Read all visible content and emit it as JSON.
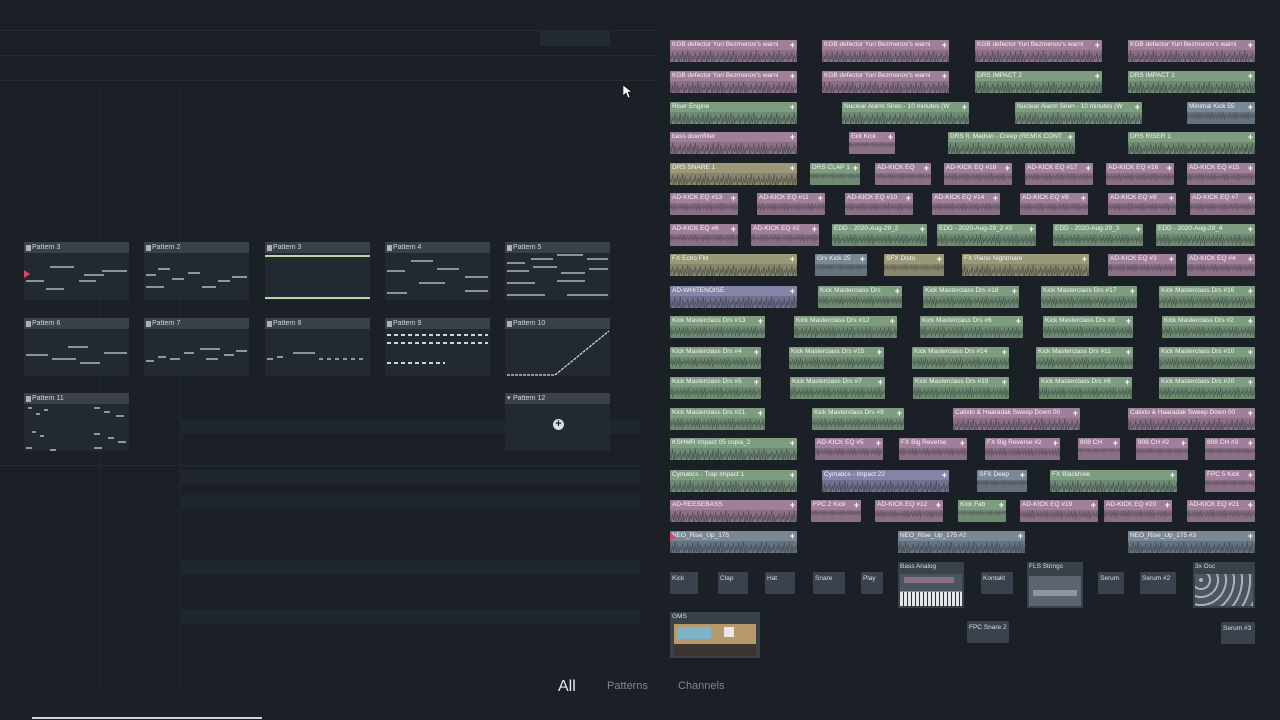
{
  "tabs": [
    {
      "label": "All",
      "active": true
    },
    {
      "label": "Patterns",
      "active": false
    },
    {
      "label": "Channels",
      "active": false
    }
  ],
  "patterns": [
    {
      "label": "Pattern 3"
    },
    {
      "label": "Pattern 2"
    },
    {
      "label": "Pattern 3"
    },
    {
      "label": "Pattern 4"
    },
    {
      "label": "Pattern 5"
    },
    {
      "label": "Pattern 6"
    },
    {
      "label": "Pattern 7"
    },
    {
      "label": "Pattern 8"
    },
    {
      "label": "Pattern 9"
    },
    {
      "label": "Pattern 10"
    },
    {
      "label": "Pattern 11"
    },
    {
      "label": "Pattern 12"
    }
  ],
  "clips": [
    {
      "label": "KGB defector Yuri Bezmenov's warni"
    },
    {
      "label": "KGB defector Yuri Bezmenov's warni"
    },
    {
      "label": "KGB defector Yuri Bezmenov's warni"
    },
    {
      "label": "KGB defector Yuri Bezmenov's warni"
    },
    {
      "label": "KGB defector Yuri Bezmenov's warni"
    },
    {
      "label": "KGB defector Yuri Bezmenov's warni"
    },
    {
      "label": "DRS IMPACT 2"
    },
    {
      "label": "DRS IMPACT 1"
    },
    {
      "label": "Riser Engine"
    },
    {
      "label": "Nuclear Alarm Siren - 10 minutes (W"
    },
    {
      "label": "Nuclear Alarm Siren - 10 minutes (W"
    },
    {
      "label": "Minimal Kick 55"
    },
    {
      "label": "bass downfilter"
    },
    {
      "label": "Ekit Kick"
    },
    {
      "label": "DRS ft. Madsin - Creep (REMIX CONT"
    },
    {
      "label": "DRS RISER 1"
    },
    {
      "label": "DRS SNARE 1"
    },
    {
      "label": "DRS CLAP 1"
    },
    {
      "label": "AD-KICK EQ"
    },
    {
      "label": "AD-KICK EQ #18"
    },
    {
      "label": "AD-KICK EQ #17"
    },
    {
      "label": "AD-KICK EQ #16"
    },
    {
      "label": "AD-KICK EQ #15"
    },
    {
      "label": "AD-KICK EQ #13"
    },
    {
      "label": "AD-KICK EQ #11"
    },
    {
      "label": "AD-KICK EQ #10"
    },
    {
      "label": "AD-KICK EQ #14"
    },
    {
      "label": "AD-KICK EQ #9"
    },
    {
      "label": "AD-KICK EQ #8"
    },
    {
      "label": "AD-KICK EQ #7"
    },
    {
      "label": "AD-KICK EQ #6"
    },
    {
      "label": "AD-KICK EQ #2"
    },
    {
      "label": "EDD - 2020-Aug-29_2"
    },
    {
      "label": "EDD - 2020-Aug-29_2 #2"
    },
    {
      "label": "EDD - 2020-Aug-29_3"
    },
    {
      "label": "EDD - 2020-Aug-29_4"
    },
    {
      "label": "FX Echo FM"
    },
    {
      "label": "Grv Kick 25"
    },
    {
      "label": "SFX Disto"
    },
    {
      "label": "FX Piano Nightmare"
    },
    {
      "label": "AD-KICK EQ #3"
    },
    {
      "label": "AD-KICK EQ #4"
    },
    {
      "label": "AD-WHITENOISE"
    },
    {
      "label": "Kick Masterclass Drs"
    },
    {
      "label": "Kick Masterclass Drs #18"
    },
    {
      "label": "Kick Masterclass Drs #17"
    },
    {
      "label": "Kick Masterclass Drs #16"
    },
    {
      "label": "Kick Masterclass Drs #13"
    },
    {
      "label": "Kick Masterclass Drs #12"
    },
    {
      "label": "Kick Masterclass Drs #6"
    },
    {
      "label": "Kick Masterclass Drs #3"
    },
    {
      "label": "Kick Masterclass Drs #2"
    },
    {
      "label": "Kick Masterclass Drs #4"
    },
    {
      "label": "Kick Masterclass Drs #15"
    },
    {
      "label": "Kick Masterclass Drs #14"
    },
    {
      "label": "Kick Masterclass Drs #11"
    },
    {
      "label": "Kick Masterclass Drs #10"
    },
    {
      "label": "Kick Masterclass Drs #5"
    },
    {
      "label": "Kick Masterclass Drs #7"
    },
    {
      "label": "Kick Masterclass Drs #19"
    },
    {
      "label": "Kick Masterclass Drs #8"
    },
    {
      "label": "Kick Masterclass Drs #20"
    },
    {
      "label": "Kick Masterclass Drs #21"
    },
    {
      "label": "Kick Masterclass Drs #9"
    },
    {
      "label": "Calixto & Haaradak Sweep Down 00"
    },
    {
      "label": "Calixto & Haaradak Sweep Down 00"
    },
    {
      "label": "KSHMR Impact 05 copia_2"
    },
    {
      "label": "AD-KICK EQ #5"
    },
    {
      "label": "FX Big Reverse"
    },
    {
      "label": "FX Big Reverse #2"
    },
    {
      "label": "808 CH"
    },
    {
      "label": "808 CH #2"
    },
    {
      "label": "808 CH #3"
    },
    {
      "label": "Cymatics - Trap Impact 1"
    },
    {
      "label": "Cymatics - Impact 22"
    },
    {
      "label": "SFX Deep"
    },
    {
      "label": "FX Blackhole"
    },
    {
      "label": "FPC 5 Kick"
    },
    {
      "label": "AD-REESEBASS"
    },
    {
      "label": "FPC 2 Kick"
    },
    {
      "label": "AD-KICK EQ #12"
    },
    {
      "label": "Kick Fab"
    },
    {
      "label": "AD-KICK EQ #19"
    },
    {
      "label": "AD-KICK EQ #20"
    },
    {
      "label": "AD-KICK EQ #21"
    },
    {
      "label": "NEO_Rise_Up_175"
    },
    {
      "label": "NEO_Rise_Up_175 #2"
    },
    {
      "label": "NEO_Rise_Up_175 #3"
    }
  ],
  "channels": [
    {
      "label": "Kick"
    },
    {
      "label": "Clap"
    },
    {
      "label": "Hat"
    },
    {
      "label": "Snare"
    },
    {
      "label": "Play"
    },
    {
      "label": "Kontakt"
    },
    {
      "label": "Serum"
    },
    {
      "label": "Serum #2"
    },
    {
      "label": "FPC Snare 2"
    },
    {
      "label": "Serum #3"
    }
  ],
  "plugins": [
    {
      "label": "Bass Analog"
    },
    {
      "label": "FLS Strings"
    },
    {
      "label": "3x Osc"
    },
    {
      "label": "GMS"
    }
  ],
  "colors": {
    "background": "#1b2027",
    "pink_clip": "#a07f9b",
    "green_clip": "#7e9c80",
    "olive_clip": "#9a9878",
    "lavender_clip": "#8583a6",
    "play_marker": "#e0436a"
  }
}
